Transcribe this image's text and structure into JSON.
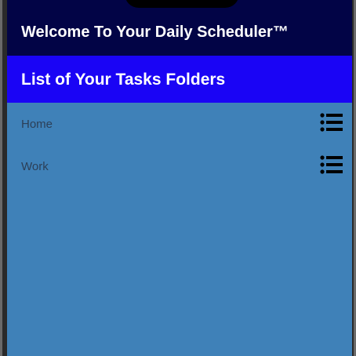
{
  "app_bar": {
    "title": "Welcome To Your Daily Scheduler™"
  },
  "section": {
    "title": "List of Your Tasks Folders"
  },
  "folders": [
    {
      "label": "Home",
      "icon": "list-icon"
    },
    {
      "label": "Work",
      "icon": "list-icon"
    }
  ],
  "colors": {
    "app_bar": "#020446",
    "section_header": "#1a04f5",
    "background": "#3f81b8",
    "folder_text": "#2c3f57"
  }
}
